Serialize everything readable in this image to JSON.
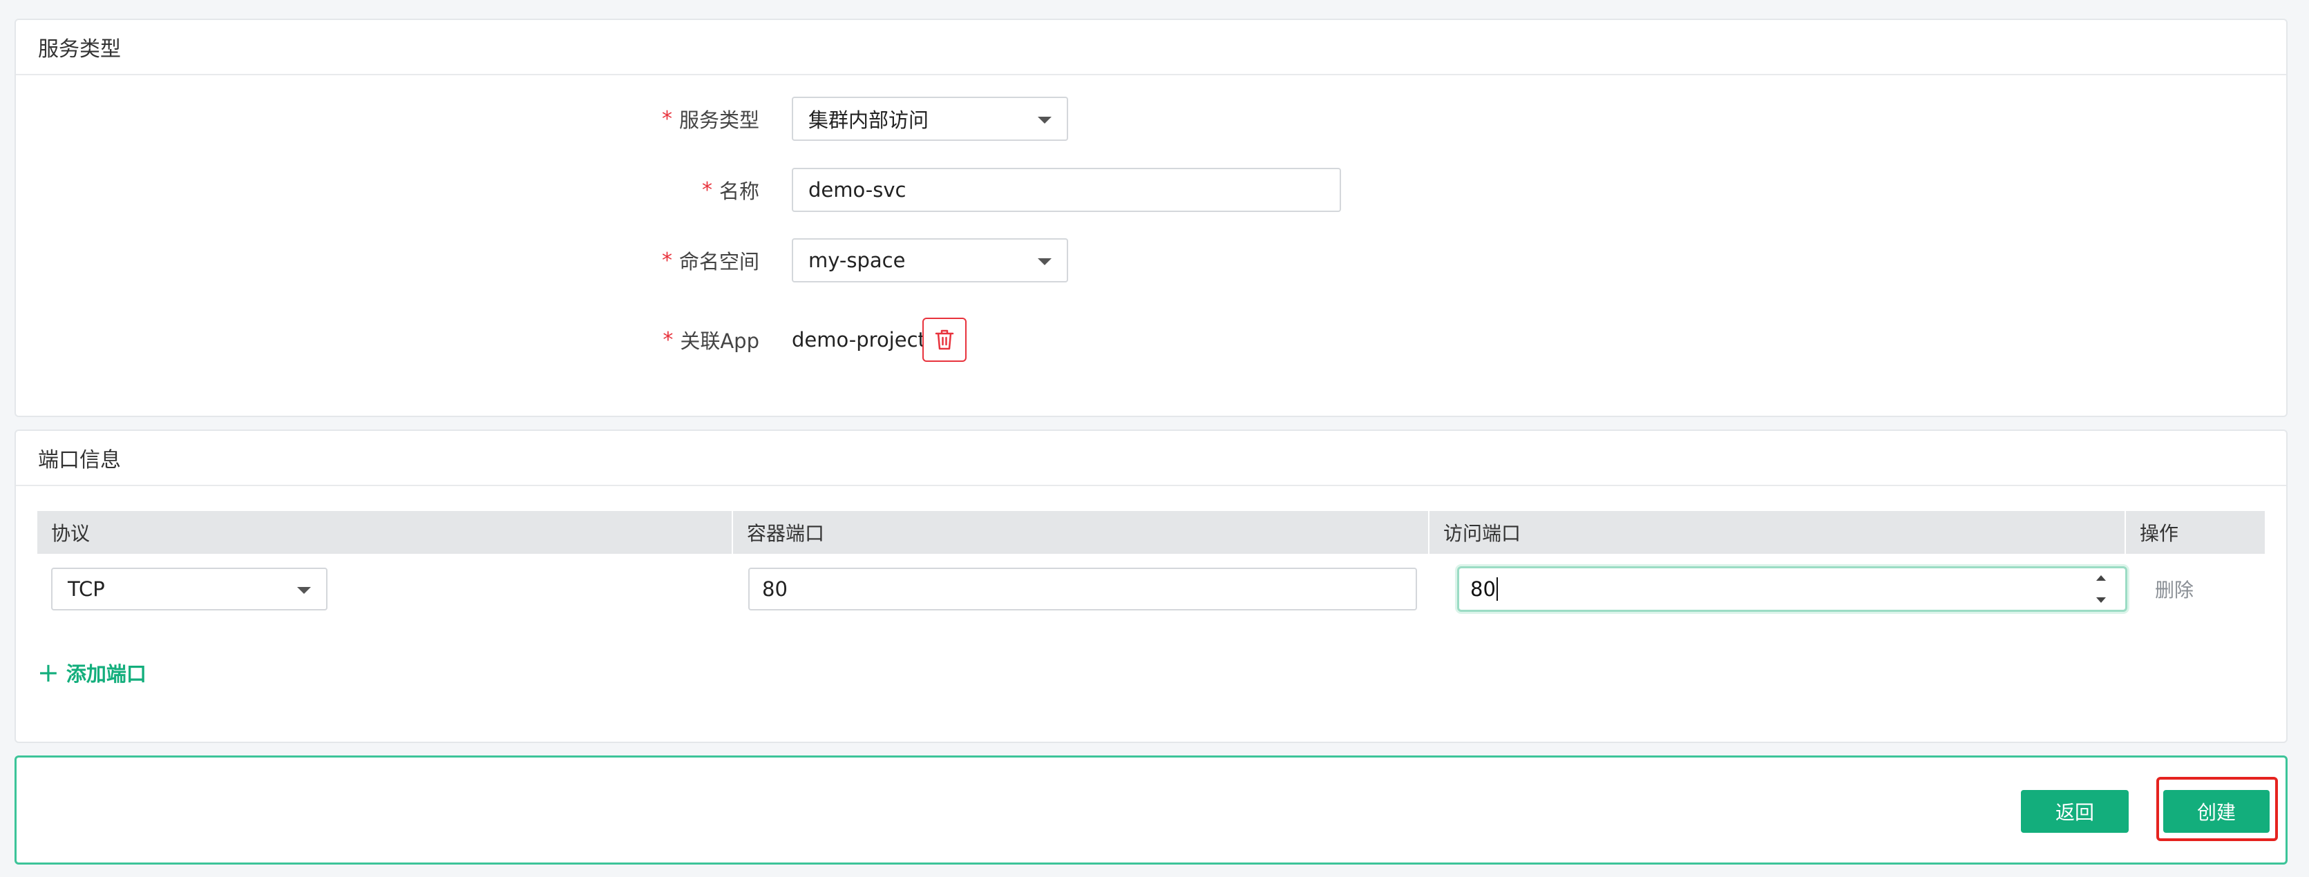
{
  "service_section": {
    "title": "服务类型",
    "fields": {
      "service_type": {
        "label": "服务类型",
        "value": "集群内部访问"
      },
      "name": {
        "label": "名称",
        "value": "demo-svc"
      },
      "namespace": {
        "label": "命名空间",
        "value": "my-space"
      },
      "app": {
        "label": "关联App",
        "value": "demo-project"
      }
    },
    "required_mark": "*"
  },
  "ports_section": {
    "title": "端口信息",
    "columns": [
      "协议",
      "容器端口",
      "访问端口",
      "操作"
    ],
    "rows": [
      {
        "protocol": "TCP",
        "container_port": "80",
        "access_port": "80",
        "action": "删除"
      }
    ],
    "add_label": "添加端口",
    "add_icon": "+"
  },
  "footer": {
    "back_label": "返回",
    "create_label": "创建"
  },
  "colors": {
    "accent": "#13ae7c",
    "required": "#e8333d",
    "highlight": "#e5231f"
  }
}
